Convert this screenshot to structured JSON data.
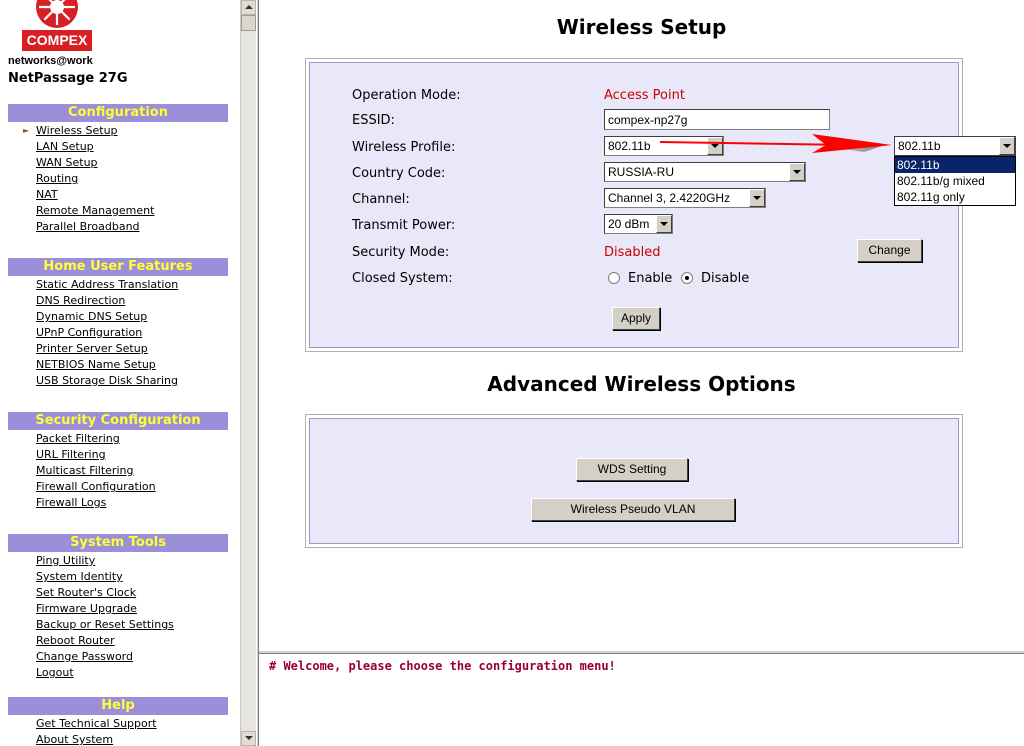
{
  "brand": {
    "logo_text": "COMPEX",
    "tagline": "networks@work",
    "model": "NetPassage 27G"
  },
  "sidebar": {
    "sections": [
      {
        "title": "Configuration",
        "items": [
          "Wireless Setup",
          "LAN Setup",
          "WAN Setup",
          "Routing",
          "NAT",
          "Remote Management",
          "Parallel Broadband"
        ]
      },
      {
        "title": "Home User Features",
        "items": [
          "Static Address Translation",
          "DNS Redirection",
          "Dynamic DNS Setup",
          "UPnP Configuration",
          "Printer Server Setup",
          "NETBIOS Name Setup",
          "USB Storage Disk Sharing"
        ]
      },
      {
        "title": "Security Configuration",
        "items": [
          "Packet Filtering",
          "URL Filtering",
          "Multicast Filtering",
          "Firewall Configuration",
          "Firewall Logs"
        ]
      },
      {
        "title": "System Tools",
        "items": [
          "Ping Utility",
          "System Identity",
          "Set Router's Clock",
          "Firmware Upgrade",
          "Backup or Reset Settings",
          "Reboot Router",
          "Change Password",
          "Logout"
        ]
      },
      {
        "title": "Help",
        "items": [
          "Get Technical Support",
          "About System"
        ]
      }
    ],
    "active_item": "Wireless Setup"
  },
  "wireless": {
    "title": "Wireless Setup",
    "operation_mode_label": "Operation Mode:",
    "operation_mode_value": "Access Point",
    "essid_label": "ESSID:",
    "essid_value": "compex-np27g",
    "profile_label": "Wireless Profile:",
    "profile_value": "802.11b",
    "country_label": "Country Code:",
    "country_value": "RUSSIA-RU",
    "channel_label": "Channel:",
    "channel_value": "Channel 3, 2.4220GHz",
    "power_label": "Transmit Power:",
    "power_value": "20 dBm",
    "security_label": "Security Mode:",
    "security_value": "Disabled",
    "change_button": "Change",
    "closed_label": "Closed System:",
    "enable_label": "Enable",
    "disable_label": "Disable",
    "closed_system_selected": "Disable",
    "apply_button": "Apply"
  },
  "advanced": {
    "title": "Advanced Wireless Options",
    "wds_button": "WDS Setting",
    "vlan_button": "Wireless Pseudo VLAN"
  },
  "profile_dropdown": {
    "selected": "802.11b",
    "options": [
      "802.11b",
      "802.11b/g mixed",
      "802.11g only"
    ]
  },
  "messages": {
    "welcome": "# Welcome, please choose the configuration menu!"
  },
  "colors": {
    "section_header_bg": "#9b8fd9",
    "section_header_text": "#ffff33",
    "panel_bg": "#e8e8f8",
    "value_red": "#cc0000",
    "arrow_red": "#ff0000",
    "welcome_text": "#990033",
    "brand_red": "#d81f26"
  }
}
